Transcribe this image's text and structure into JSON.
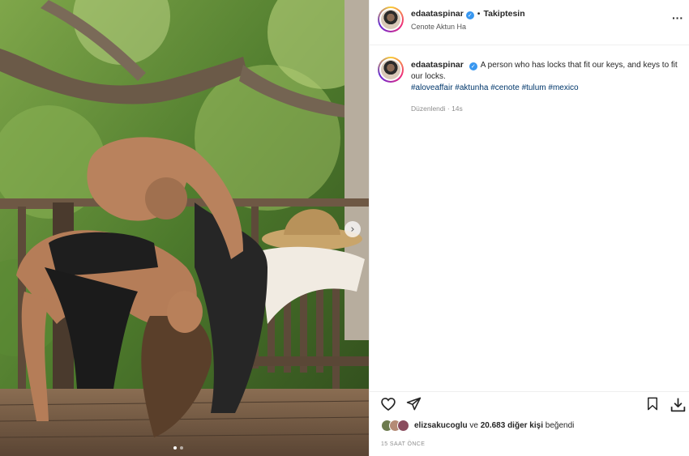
{
  "post": {
    "username": "edaataspinar",
    "verified": true,
    "follow_status": "Takiptesin",
    "location": "Cenote Aktun Ha",
    "more_icon": "more-horizontal-icon"
  },
  "caption": {
    "username": "edaataspinar",
    "text": "A person who has locks that fit our keys, and keys to fit our locks.",
    "hashtags": "#aloveaffair #aktunha #cenote #tulum #mexico",
    "edited": "Düzenlendi · 14s"
  },
  "actions": {
    "icons": [
      "heart-icon",
      "share-icon",
      "bookmark-icon",
      "download-icon"
    ]
  },
  "likes": {
    "first_user": "elizsakucoglu",
    "connector": "ve",
    "count_text": "20.683 diğer kişi",
    "suffix": "beğendi"
  },
  "timestamp": "15 SAAT ÖNCE",
  "carousel": {
    "slides": 2,
    "current": 1
  },
  "colors": {
    "link": "#00376b",
    "verified": "#3897f0",
    "muted": "#8e8e8e"
  }
}
